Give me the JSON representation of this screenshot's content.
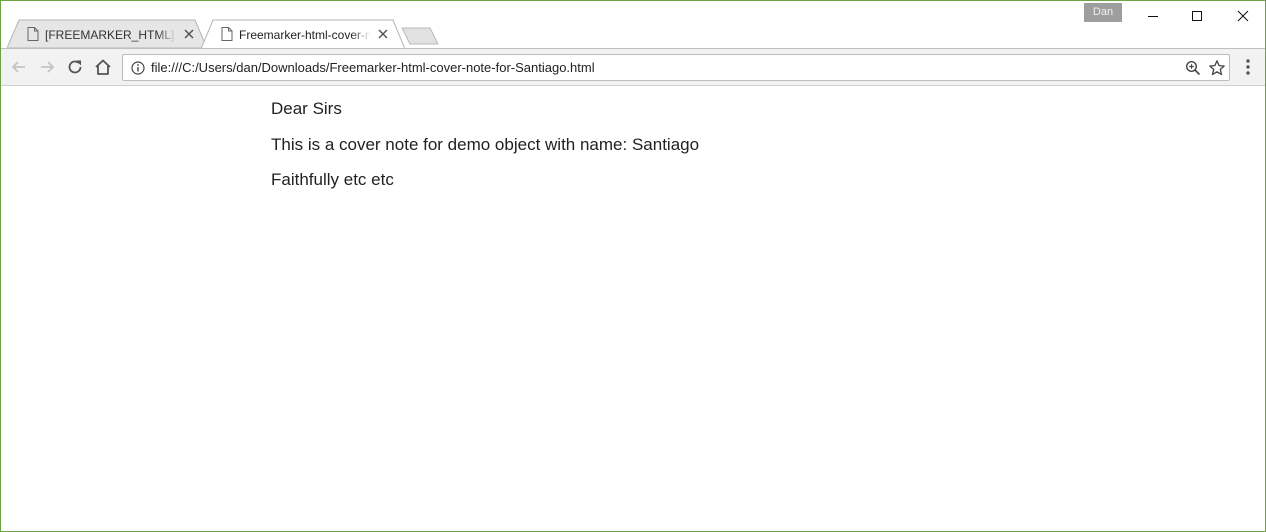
{
  "tabs": [
    {
      "title": "[FREEMARKER_HTML] Freemarker-html-cover-note",
      "active": false
    },
    {
      "title": "Freemarker-html-cover-note-for-Santiago.html",
      "active": true
    }
  ],
  "profile": {
    "name": "Dan"
  },
  "toolbar": {
    "url": "file:///C:/Users/dan/Downloads/Freemarker-html-cover-note-for-Santiago.html"
  },
  "page": {
    "lines": [
      "Dear Sirs",
      "This is a cover note for demo object with name: Santiago",
      "Faithfully etc etc"
    ]
  },
  "colors": {
    "window_border": "#6fa33f",
    "toolbar_bg": "#f2f2f2",
    "inactive_tab_bg": "#e6e6e6",
    "profile_badge_bg": "#9e9e9e"
  }
}
